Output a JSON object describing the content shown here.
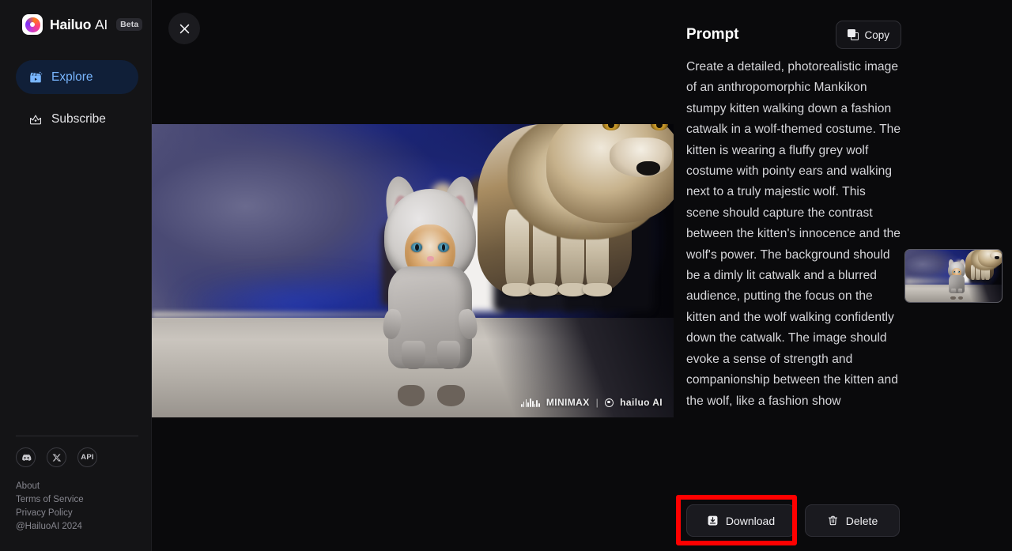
{
  "app": {
    "brand_name": "Hailuo",
    "brand_suffix": "AI",
    "beta_badge": "Beta",
    "logo_icon": "hailuo-swirl-logo"
  },
  "titlebar": {
    "close_icon": "close-icon"
  },
  "sidebar": {
    "items": [
      {
        "label": "Explore",
        "icon": "clapperboard-icon",
        "active": true
      },
      {
        "label": "Subscribe",
        "icon": "crown-icon",
        "active": false
      }
    ],
    "socials": [
      {
        "name": "discord",
        "icon": "discord-icon",
        "label": ""
      },
      {
        "name": "x",
        "icon": "x-twitter-icon",
        "label": ""
      },
      {
        "name": "api",
        "icon": "api-icon",
        "label": "API"
      }
    ],
    "legal": {
      "about": "About",
      "terms": "Terms of Service",
      "privacy": "Privacy Policy",
      "copyright": "@HailuoAI 2024"
    }
  },
  "media": {
    "alt": "Anthropomorphic kitten in grey wolf costume walking a fashion catwalk beside a majestic wolf",
    "watermark_brand": "MINIMAX",
    "watermark_separator": "|",
    "watermark_product": "hailuo AI",
    "thumbnail_name": "result-thumbnail"
  },
  "prompt": {
    "heading": "Prompt",
    "copy_label": "Copy",
    "copy_icon": "copy-icon",
    "text": "Create a detailed, photorealistic image of an anthropomorphic Mankikon stumpy kitten walking down a fashion catwalk in a wolf-themed costume. The kitten is wearing a fluffy grey wolf costume with pointy ears and walking next to a truly majestic wolf. This scene should capture the contrast between the kitten's innocence and the wolf's power. The background should be a dimly lit catwalk and a blurred audience, putting the focus on the kitten and the wolf walking confidently down the catwalk. The image should evoke a sense of strength and companionship between the kitten and the wolf, like a fashion show"
  },
  "actions": {
    "download_label": "Download",
    "download_icon": "download-icon",
    "delete_label": "Delete",
    "delete_icon": "trash-icon"
  },
  "annotation": {
    "highlight_target": "Download",
    "highlight_color": "#ff0000"
  },
  "colors": {
    "page_background": "#0a0a0c",
    "sidebar_background": "#141416",
    "accent_blue": "#79b6ff",
    "active_pill": "#101f38",
    "button_background": "#1a1a1f",
    "muted_text": "#86868e",
    "body_text": "#d6d6da"
  }
}
